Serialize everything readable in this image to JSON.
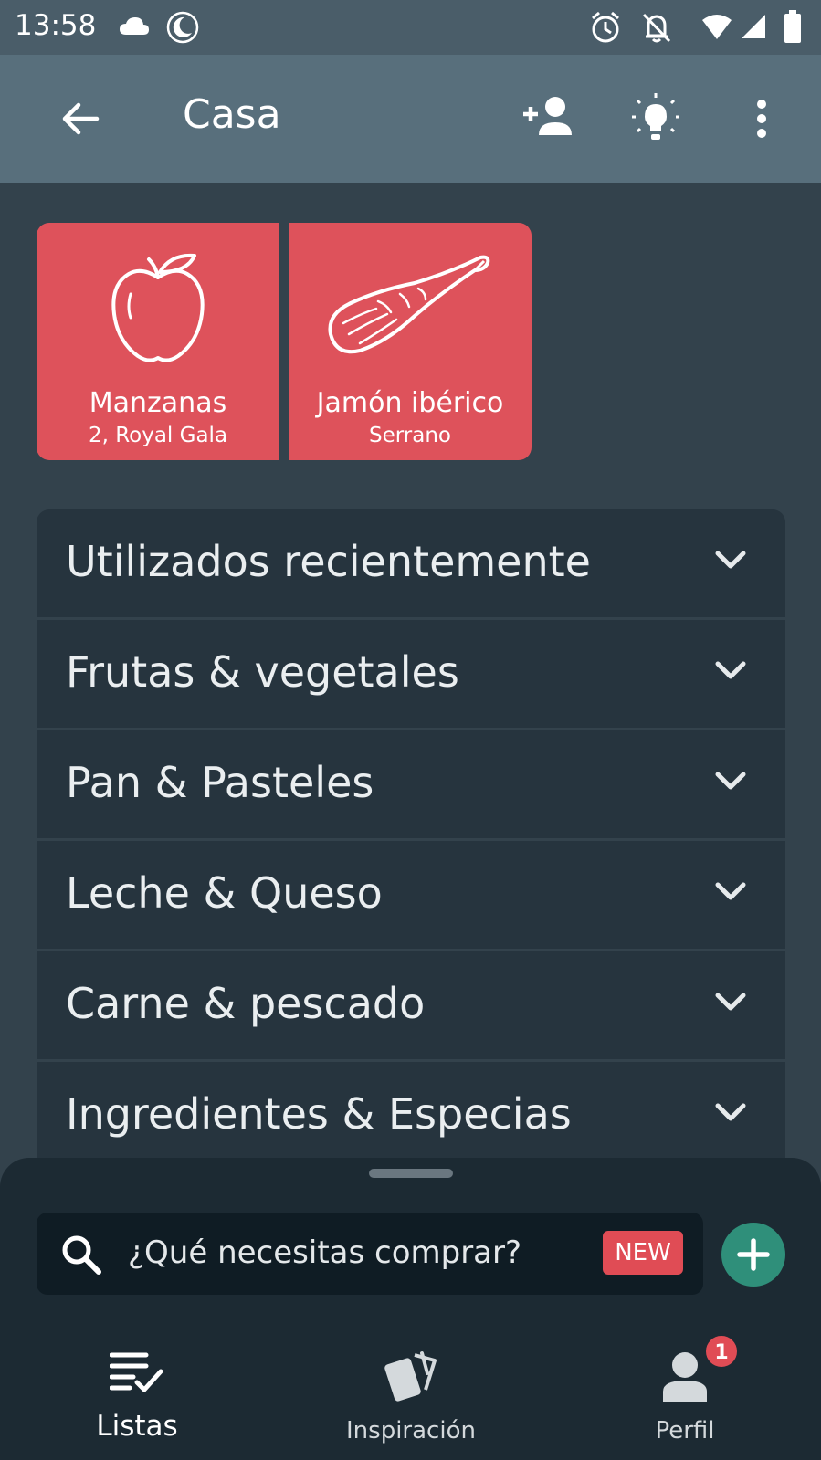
{
  "status_bar": {
    "time": "13:58",
    "icons": [
      "cloud-icon",
      "moon-icon",
      "alarm-icon",
      "bell-off-icon",
      "wifi-icon",
      "signal-icon",
      "battery-icon"
    ]
  },
  "app_bar": {
    "title": "Casa",
    "icons": [
      "back-arrow-icon",
      "add-person-icon",
      "lightbulb-icon",
      "more-vert-icon"
    ]
  },
  "tiles": [
    {
      "name": "Manzanas",
      "subtitle": "2, Royal Gala",
      "icon": "apple-icon"
    },
    {
      "name": "Jamón ibérico",
      "subtitle": "Serrano",
      "icon": "ham-icon"
    }
  ],
  "categories": [
    {
      "label": "Utilizados recientemente"
    },
    {
      "label": "Frutas & vegetales"
    },
    {
      "label": "Pan & Pasteles"
    },
    {
      "label": "Leche & Queso"
    },
    {
      "label": "Carne & pescado"
    },
    {
      "label": "Ingredientes & Especias"
    }
  ],
  "search": {
    "placeholder": "¿Qué necesitas comprar?",
    "badge": "NEW"
  },
  "bottom_nav": {
    "items": [
      {
        "label": "Listas",
        "icon": "list-check-icon",
        "active": true
      },
      {
        "label": "Inspiración",
        "icon": "cards-icon",
        "active": false
      },
      {
        "label": "Perfil",
        "icon": "person-icon",
        "active": false,
        "badge": "1"
      }
    ]
  },
  "colors": {
    "app_bar": "#586f7c",
    "background": "#33424c",
    "tile": "#de525b",
    "accent_green": "#2f8f7a",
    "badge_red": "#e04c55"
  }
}
